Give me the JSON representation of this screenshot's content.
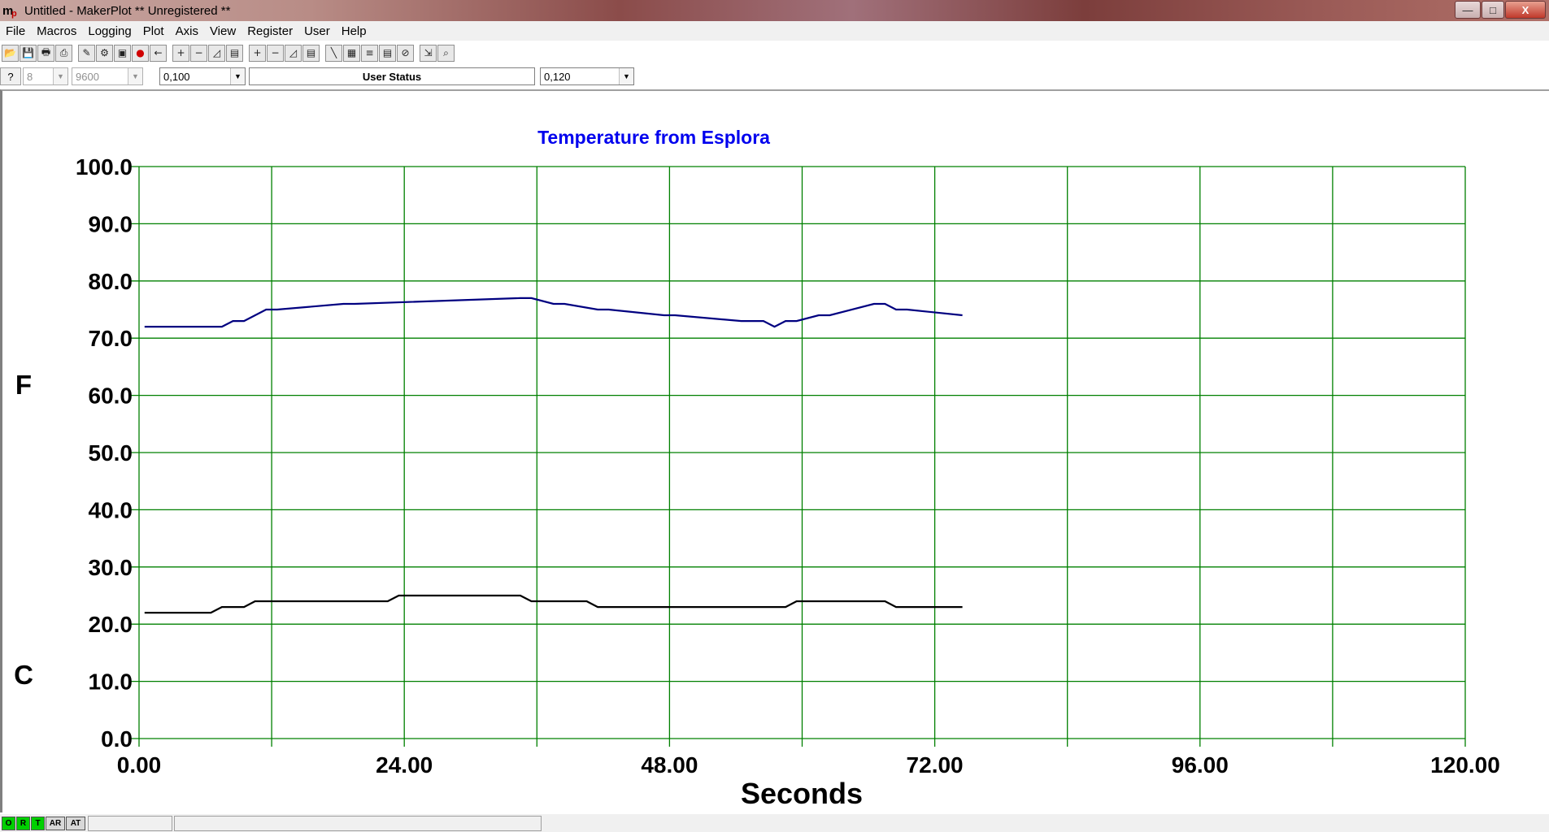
{
  "window": {
    "title": "Untitled - MakerPlot ** Unregistered **",
    "app_icon": "makerplot-logo-icon",
    "controls": {
      "minimize": "—",
      "maximize": "□",
      "close": "X"
    }
  },
  "menu": [
    "File",
    "Macros",
    "Logging",
    "Plot",
    "Axis",
    "View",
    "Register",
    "User",
    "Help"
  ],
  "toolbar": {
    "groups": [
      [
        "open-icon",
        "save-icon",
        "print-icon",
        "snapshot-icon"
      ],
      [
        "pen-icon",
        "macro-icon",
        "monitor-icon",
        "record-icon",
        "back-arrow-icon"
      ],
      [
        "x-zoom-in-icon",
        "x-zoom-out-icon",
        "x-fit-icon",
        "x-reset-icon"
      ],
      [
        "y-zoom-in-icon",
        "y-zoom-out-icon",
        "y-fit-icon",
        "y-reset-icon"
      ],
      [
        "draw-line-icon",
        "grid-icon",
        "notes-icon",
        "clipboard-icon",
        "probe-icon"
      ],
      [
        "scale-icon",
        "search-icon"
      ]
    ],
    "glyphs": {
      "open-icon": "📂",
      "save-icon": "💾",
      "print-icon": "🖶",
      "snapshot-icon": "⎙",
      "pen-icon": "✎",
      "macro-icon": "⚙",
      "monitor-icon": "▣",
      "record-icon": "●",
      "back-arrow-icon": "←",
      "x-zoom-in-icon": "+",
      "x-zoom-out-icon": "−",
      "x-fit-icon": "◿",
      "x-reset-icon": "▤",
      "y-zoom-in-icon": "+",
      "y-zoom-out-icon": "−",
      "y-fit-icon": "◿",
      "y-reset-icon": "▤",
      "draw-line-icon": "╲",
      "grid-icon": "▦",
      "notes-icon": "≡",
      "clipboard-icon": "▤",
      "probe-icon": "⊘",
      "scale-icon": "⇲",
      "search-icon": "⌕"
    }
  },
  "settings": {
    "help_label": "?",
    "com_port": "8",
    "baud_rate": "9600",
    "interval": "0,100",
    "user_status": "User Status",
    "span": "0,120"
  },
  "statusbar": {
    "leds": [
      {
        "label": "O",
        "state": "on"
      },
      {
        "label": "R",
        "state": "on"
      },
      {
        "label": "T",
        "state": "on"
      },
      {
        "label": "AR",
        "state": "off"
      },
      {
        "label": "AT",
        "state": "off"
      }
    ]
  },
  "chart_data": {
    "type": "line",
    "title": "Temperature from Esplora",
    "xlabel": "Seconds",
    "ylabel_top": "F",
    "ylabel_bottom": "C",
    "xlim": [
      0,
      120
    ],
    "ylim": [
      0,
      100
    ],
    "x_ticks": [
      "0.00",
      "24.00",
      "48.00",
      "72.00",
      "96.00",
      "120.00"
    ],
    "x_tick_values": [
      0,
      24,
      48,
      72,
      96,
      120
    ],
    "x_grid_step": 12,
    "y_ticks": [
      "0.0",
      "10.0",
      "20.0",
      "30.0",
      "40.0",
      "50.0",
      "60.0",
      "70.0",
      "80.0",
      "90.0",
      "100.0"
    ],
    "grid": true,
    "colors": {
      "title": "#0000ee",
      "grid": "#008000",
      "fahrenheit": "#000080",
      "celsius": "#000000"
    },
    "series": [
      {
        "color": "#000080",
        "x": [
          0.5,
          6.5,
          7.5,
          8.5,
          9.5,
          11.5,
          12.5,
          18.5,
          19.5,
          34.5,
          35.5,
          37.5,
          38.5,
          41.5,
          42.5,
          47.5,
          48.5,
          54.5,
          55.5,
          56.5,
          57.5,
          58.5,
          59.5,
          61.5,
          62.5,
          66.5,
          67.5,
          68.5,
          69.5,
          74.5
        ],
        "y": [
          72,
          72,
          72,
          73,
          73,
          75,
          75,
          76,
          76,
          77,
          77,
          76,
          76,
          75,
          75,
          74,
          74,
          73,
          73,
          73,
          72,
          73,
          73,
          74,
          74,
          76,
          76,
          75,
          75,
          74
        ]
      },
      {
        "color": "#000000",
        "x": [
          0.5,
          6.5,
          7.5,
          9.5,
          10.5,
          22.5,
          23.5,
          34.5,
          35.5,
          40.5,
          41.5,
          58.5,
          59.5,
          67.5,
          68.5,
          74.5
        ],
        "y": [
          22,
          22,
          23,
          23,
          24,
          24,
          25,
          25,
          24,
          24,
          23,
          23,
          24,
          24,
          23,
          23
        ]
      }
    ]
  }
}
